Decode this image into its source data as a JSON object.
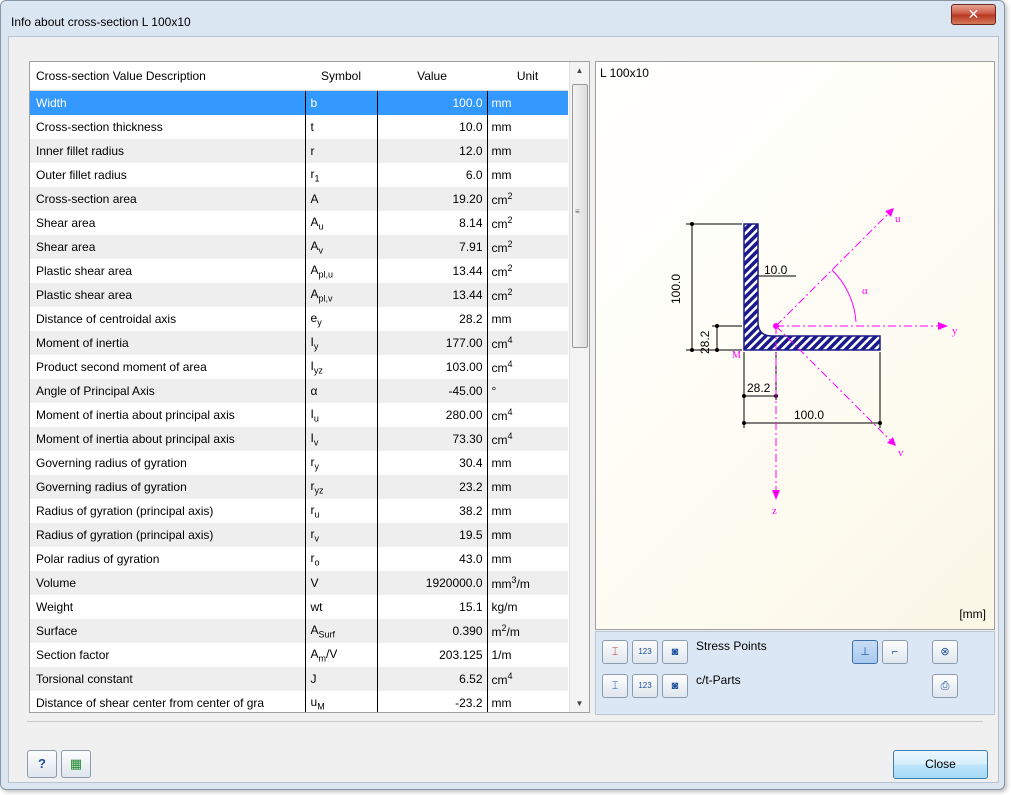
{
  "window": {
    "title": "Info about cross-section L 100x10",
    "close_glyph": "✕"
  },
  "table": {
    "headers": {
      "description": "Cross-section Value Description",
      "symbol": "Symbol",
      "value": "Value",
      "unit": "Unit"
    },
    "rows": [
      {
        "desc": "Width",
        "sym": "b",
        "sub": "",
        "val": "100.0",
        "unit": "mm",
        "sup": "",
        "unit_tail": ""
      },
      {
        "desc": "Cross-section thickness",
        "sym": "t",
        "sub": "",
        "val": "10.0",
        "unit": "mm",
        "sup": "",
        "unit_tail": ""
      },
      {
        "desc": "Inner fillet radius",
        "sym": "r",
        "sub": "",
        "val": "12.0",
        "unit": "mm",
        "sup": "",
        "unit_tail": ""
      },
      {
        "desc": "Outer fillet radius",
        "sym": "r",
        "sub": "1",
        "val": "6.0",
        "unit": "mm",
        "sup": "",
        "unit_tail": ""
      },
      {
        "desc": "Cross-section area",
        "sym": "A",
        "sub": "",
        "val": "19.20",
        "unit": "cm",
        "sup": "2",
        "unit_tail": ""
      },
      {
        "desc": "Shear area",
        "sym": "A",
        "sub": "u",
        "val": "8.14",
        "unit": "cm",
        "sup": "2",
        "unit_tail": ""
      },
      {
        "desc": "Shear area",
        "sym": "A",
        "sub": "v",
        "val": "7.91",
        "unit": "cm",
        "sup": "2",
        "unit_tail": ""
      },
      {
        "desc": "Plastic shear area",
        "sym": "A",
        "sub": "pl,u",
        "val": "13.44",
        "unit": "cm",
        "sup": "2",
        "unit_tail": ""
      },
      {
        "desc": "Plastic shear area",
        "sym": "A",
        "sub": "pl,v",
        "val": "13.44",
        "unit": "cm",
        "sup": "2",
        "unit_tail": ""
      },
      {
        "desc": "Distance of centroidal axis",
        "sym": "e",
        "sub": "y",
        "val": "28.2",
        "unit": "mm",
        "sup": "",
        "unit_tail": ""
      },
      {
        "desc": "Moment of inertia",
        "sym": "I",
        "sub": "y",
        "val": "177.00",
        "unit": "cm",
        "sup": "4",
        "unit_tail": ""
      },
      {
        "desc": "Product second moment of area",
        "sym": "I",
        "sub": "yz",
        "val": "103.00",
        "unit": "cm",
        "sup": "4",
        "unit_tail": ""
      },
      {
        "desc": "Angle of Principal Axis",
        "sym": "α",
        "sub": "",
        "val": "-45.00",
        "unit": "°",
        "sup": "",
        "unit_tail": ""
      },
      {
        "desc": "Moment of inertia about principal axis",
        "sym": "I",
        "sub": "u",
        "val": "280.00",
        "unit": "cm",
        "sup": "4",
        "unit_tail": ""
      },
      {
        "desc": "Moment of inertia about principal axis",
        "sym": "I",
        "sub": "v",
        "val": "73.30",
        "unit": "cm",
        "sup": "4",
        "unit_tail": ""
      },
      {
        "desc": "Governing radius of gyration",
        "sym": "r",
        "sub": "y",
        "val": "30.4",
        "unit": "mm",
        "sup": "",
        "unit_tail": ""
      },
      {
        "desc": "Governing radius of gyration",
        "sym": "r",
        "sub": "yz",
        "val": "23.2",
        "unit": "mm",
        "sup": "",
        "unit_tail": ""
      },
      {
        "desc": "Radius of gyration (principal axis)",
        "sym": "r",
        "sub": "u",
        "val": "38.2",
        "unit": "mm",
        "sup": "",
        "unit_tail": ""
      },
      {
        "desc": "Radius of gyration (principal axis)",
        "sym": "r",
        "sub": "v",
        "val": "19.5",
        "unit": "mm",
        "sup": "",
        "unit_tail": ""
      },
      {
        "desc": "Polar radius of gyration",
        "sym": "r",
        "sub": "o",
        "val": "43.0",
        "unit": "mm",
        "sup": "",
        "unit_tail": ""
      },
      {
        "desc": "Volume",
        "sym": "V",
        "sub": "",
        "val": "1920000.0",
        "unit": "mm",
        "sup": "3",
        "unit_tail": "/m"
      },
      {
        "desc": "Weight",
        "sym": "wt",
        "sub": "",
        "val": "15.1",
        "unit": "kg/m",
        "sup": "",
        "unit_tail": ""
      },
      {
        "desc": "Surface",
        "sym": "A",
        "sub": "Surf",
        "val": "0.390",
        "unit": "m",
        "sup": "2",
        "unit_tail": "/m"
      },
      {
        "desc": "Section factor",
        "sym": "A",
        "sub": "m",
        "sym_tail": "/V",
        "val": "203.125",
        "unit": "1/m",
        "sup": "",
        "unit_tail": ""
      },
      {
        "desc": "Torsional constant",
        "sym": "J",
        "sub": "",
        "val": "6.52",
        "unit": "cm",
        "sup": "4",
        "unit_tail": ""
      },
      {
        "desc": "Distance of shear center from center of gra",
        "sym": "u",
        "sub": "M",
        "val": "-23.2",
        "unit": "mm",
        "sup": "",
        "unit_tail": ""
      }
    ]
  },
  "graphic": {
    "title": "L 100x10",
    "unit": "[mm]",
    "dims": {
      "height": "100.0",
      "thickness": "10.0",
      "ey": "28.2",
      "ez": "28.2",
      "width": "100.0"
    },
    "axes": {
      "y": "y",
      "z": "z",
      "u": "u",
      "v": "v",
      "alpha": "α",
      "point": "M"
    },
    "colors": {
      "section": "#1a1a8c",
      "axes": "#ff00ff",
      "dims": "#000000"
    }
  },
  "toolbar": {
    "stress_points": "Stress Points",
    "ct_parts": "c/t-Parts",
    "num_glyph": "123"
  },
  "footer": {
    "close": "Close",
    "help_glyph": "?"
  }
}
